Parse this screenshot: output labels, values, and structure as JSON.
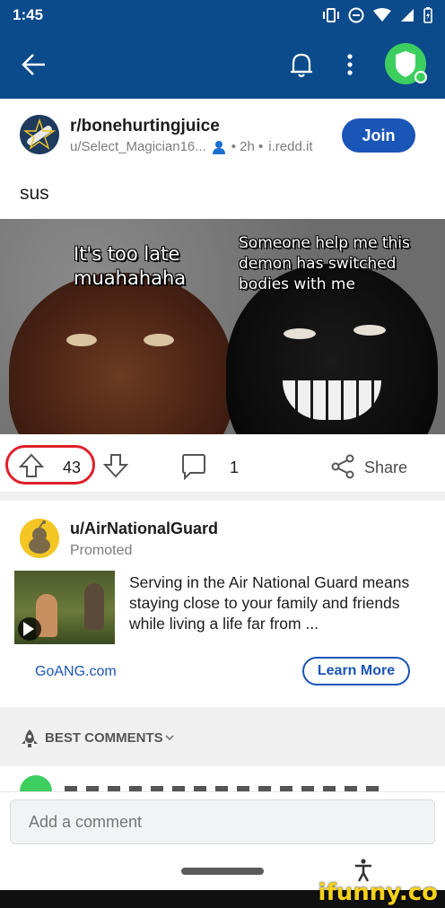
{
  "status_bar": {
    "time": "1:45"
  },
  "app_bar": {
    "icons": [
      "back-arrow-icon",
      "bell-icon",
      "more-vertical-icon",
      "shield-avatar-icon"
    ]
  },
  "post": {
    "subreddit": "r/bonehurtingjuice",
    "author": "u/Select_Magician16...",
    "age": "• 2h •",
    "domain": "i.redd.it",
    "join_label": "Join",
    "title": "sus",
    "meme_left_text": "It's too late\nmuahahaha",
    "meme_right_text": "Someone help me this\ndemon has switched\nbodies with me",
    "vote_count": "43",
    "comment_count": "1",
    "share_label": "Share"
  },
  "promo": {
    "user": "u/AirNationalGuard",
    "tag": "Promoted",
    "body": "Serving in the Air National Guard means staying close to your family and friends while living a life far from ...",
    "link": "GoANG.com",
    "cta": "Learn More"
  },
  "comments": {
    "sort_label": "BEST COMMENTS"
  },
  "composer": {
    "placeholder": "Add a comment"
  },
  "watermark": "ifunny.co",
  "colors": {
    "brand_blue": "#0b4a8b",
    "join_blue": "#1a55b8",
    "highlight_red": "#e0202a",
    "avatar_green": "#3ccf5f"
  }
}
